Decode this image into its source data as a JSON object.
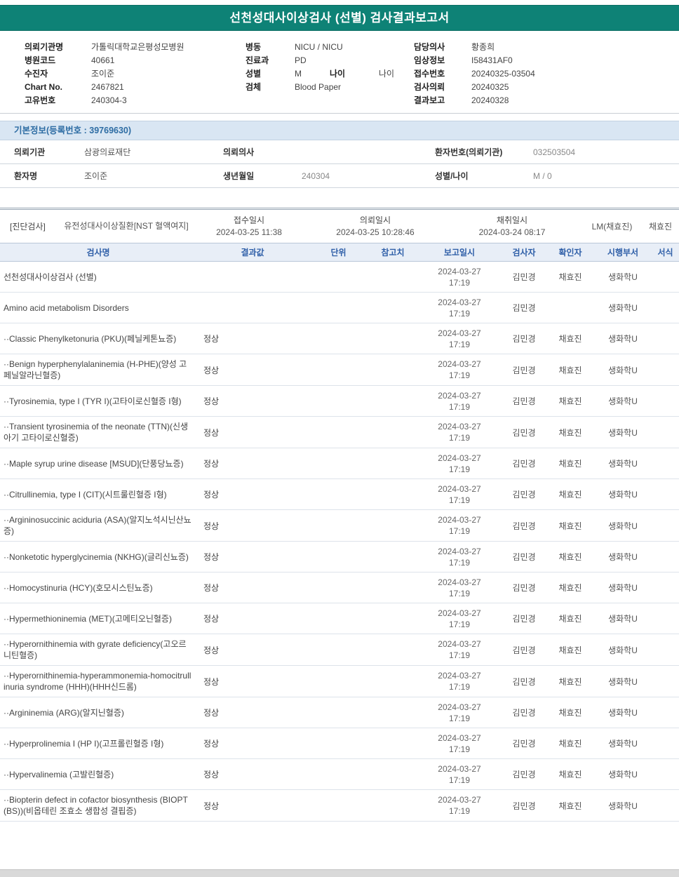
{
  "title": "선천성대사이상검사 (선별) 검사결과보고서",
  "colors": {
    "titlebar": "#0e8276",
    "accent_blue": "#2e6da4",
    "band_bg": "#d9e6f3",
    "table_head_bg": "#e8eef7"
  },
  "header": {
    "left": [
      {
        "label": "의뢰기관명",
        "value": "가톨릭대학교은평성모병원"
      },
      {
        "label": "병원코드",
        "value": "40661"
      },
      {
        "label": "수진자",
        "value": "조이준"
      },
      {
        "label": "Chart No.",
        "value": "2467821"
      },
      {
        "label": "고유번호",
        "value": "240304-3"
      }
    ],
    "middle": [
      {
        "label": "병동",
        "value": "NICU / NICU"
      },
      {
        "label": "진료과",
        "value": "PD"
      },
      {
        "label": "성별",
        "value": "M",
        "label2": "나이",
        "value2": "나이"
      },
      {
        "label": "검체",
        "value": "Blood Paper"
      }
    ],
    "right": [
      {
        "label": "담당의사",
        "value": "황종희"
      },
      {
        "label": "임상정보",
        "value": "I58431AF0"
      },
      {
        "label": "접수번호",
        "value": "20240325-03504"
      },
      {
        "label": "검사의뢰",
        "value": "20240325"
      },
      {
        "label": "결과보고",
        "value": "20240328"
      }
    ]
  },
  "basic_info": {
    "section_title": "기본정보(등록번호 : 39769630)",
    "rows": [
      [
        {
          "label": "의뢰기관",
          "value": "삼광의료재단"
        },
        {
          "label": "의뢰의사",
          "value": ""
        },
        {
          "label": "환자번호(의뢰기관)",
          "value": "032503504"
        }
      ],
      [
        {
          "label": "환자명",
          "value": "조이준"
        },
        {
          "label": "생년월일",
          "value": "240304"
        },
        {
          "label": "성별/나이",
          "value": "M / 0"
        }
      ]
    ]
  },
  "diagnostic": {
    "tag": "[진단검사]",
    "test_group": "유전성대사이상질환[NST 혈액여지]",
    "datetimes": [
      {
        "label": "접수일시",
        "value": "2024-03-25 11:38"
      },
      {
        "label": "의뢰일시",
        "value": "2024-03-25 10:28:46"
      },
      {
        "label": "채취일시",
        "value": "2024-03-24 08:17"
      }
    ],
    "sampler": "LM(채효진)",
    "confirmer": "채효진"
  },
  "results_table": {
    "headers": [
      "검사명",
      "결과값",
      "단위",
      "참고치",
      "보고일시",
      "검사자",
      "확인자",
      "시행부서",
      "서식"
    ],
    "rows": [
      {
        "name": "선천성대사이상검사 (선별)",
        "result": "",
        "reported": "2024-03-27 17:19",
        "tester": "김민경",
        "confirmer": "채효진",
        "dept": "생화학U"
      },
      {
        "name": "Amino acid metabolism Disorders",
        "result": "",
        "reported": "2024-03-27 17:19",
        "tester": "김민경",
        "confirmer": "",
        "dept": "생화학U"
      },
      {
        "name": "··Classic Phenylketonuria (PKU)(페닐케톤뇨증)",
        "result": "정상",
        "reported": "2024-03-27 17:19",
        "tester": "김민경",
        "confirmer": "채효진",
        "dept": "생화학U"
      },
      {
        "name": "··Benign hyperphenylalaninemia (H-PHE)(양성 고페닐알라닌혈증)",
        "result": "정상",
        "reported": "2024-03-27 17:19",
        "tester": "김민경",
        "confirmer": "채효진",
        "dept": "생화학U"
      },
      {
        "name": "··Tyrosinemia, type I (TYR I)(고타이로신혈증 I형)",
        "result": "정상",
        "reported": "2024-03-27 17:19",
        "tester": "김민경",
        "confirmer": "채효진",
        "dept": "생화학U"
      },
      {
        "name": "··Transient tyrosinemia of the neonate (TTN)(신생아기 고타이로신혈증)",
        "result": "정상",
        "reported": "2024-03-27 17:19",
        "tester": "김민경",
        "confirmer": "채효진",
        "dept": "생화학U"
      },
      {
        "name": "··Maple syrup urine disease [MSUD](단풍당뇨증)",
        "result": "정상",
        "reported": "2024-03-27 17:19",
        "tester": "김민경",
        "confirmer": "채효진",
        "dept": "생화학U"
      },
      {
        "name": "··Citrullinemia, type I (CIT)(시트룰린혈증 I형)",
        "result": "정상",
        "reported": "2024-03-27 17:19",
        "tester": "김민경",
        "confirmer": "채효진",
        "dept": "생화학U"
      },
      {
        "name": "··Argininosuccinic aciduria (ASA)(알지노석시닌산뇨증)",
        "result": "정상",
        "reported": "2024-03-27 17:19",
        "tester": "김민경",
        "confirmer": "채효진",
        "dept": "생화학U"
      },
      {
        "name": "··Nonketotic hyperglycinemia (NKHG)(글리신뇨증)",
        "result": "정상",
        "reported": "2024-03-27 17:19",
        "tester": "김민경",
        "confirmer": "채효진",
        "dept": "생화학U"
      },
      {
        "name": "··Homocystinuria (HCY)(호모시스틴뇨증)",
        "result": "정상",
        "reported": "2024-03-27 17:19",
        "tester": "김민경",
        "confirmer": "채효진",
        "dept": "생화학U"
      },
      {
        "name": "··Hypermethioninemia (MET)(고메티오닌혈증)",
        "result": "정상",
        "reported": "2024-03-27 17:19",
        "tester": "김민경",
        "confirmer": "채효진",
        "dept": "생화학U"
      },
      {
        "name": "··Hyperornithinemia with gyrate deficiency(고오르니틴혈증)",
        "result": "정상",
        "reported": "2024-03-27 17:19",
        "tester": "김민경",
        "confirmer": "채효진",
        "dept": "생화학U"
      },
      {
        "name": "··Hyperornithinemia-hyperammonemia-homocitrullinuria syndrome (HHH)(HHH신드롬)",
        "result": "정상",
        "reported": "2024-03-27 17:19",
        "tester": "김민경",
        "confirmer": "채효진",
        "dept": "생화학U"
      },
      {
        "name": "··Argininemia (ARG)(알지닌혈증)",
        "result": "정상",
        "reported": "2024-03-27 17:19",
        "tester": "김민경",
        "confirmer": "채효진",
        "dept": "생화학U"
      },
      {
        "name": "··Hyperprolinemia I (HP I)(고프롤린혈증 I형)",
        "result": "정상",
        "reported": "2024-03-27 17:19",
        "tester": "김민경",
        "confirmer": "채효진",
        "dept": "생화학U"
      },
      {
        "name": "··Hypervalinemia (고발린혈증)",
        "result": "정상",
        "reported": "2024-03-27 17:19",
        "tester": "김민경",
        "confirmer": "채효진",
        "dept": "생화학U"
      },
      {
        "name": "··Biopterin defect in cofactor biosynthesis (BIOPT(BS))(비옵테린 조효소 생합성 결핍증)",
        "result": "정상",
        "reported": "2024-03-27 17:19",
        "tester": "김민경",
        "confirmer": "채효진",
        "dept": "생화학U"
      }
    ]
  }
}
